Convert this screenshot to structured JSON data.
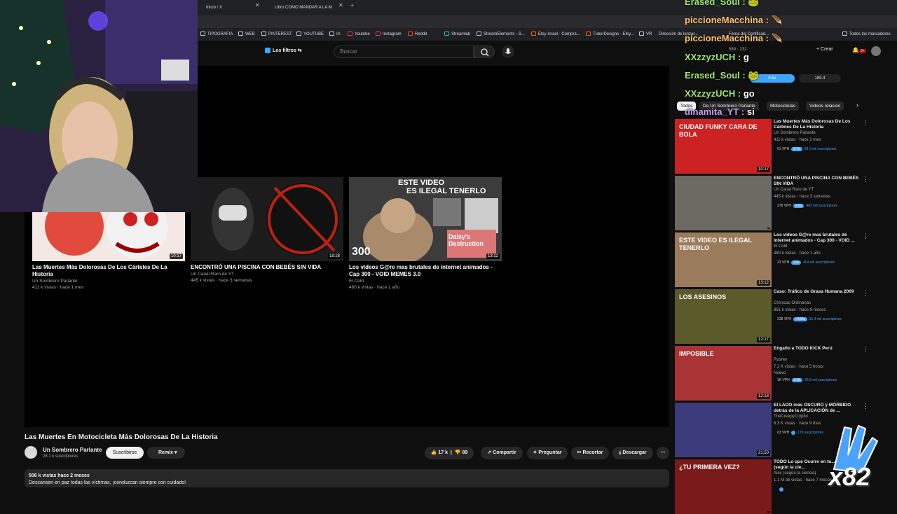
{
  "browser": {
    "tabs": [
      {
        "label": "Inicio / X"
      },
      {
        "label": "Libro COMO MANDAR A LA M"
      }
    ],
    "bookmarks": [
      "TIPOGRAFIA",
      "WEB",
      "PINTEREST",
      "YOUTUBE",
      "IA",
      "Youtube",
      "Instagram",
      "Reddit",
      "Streamlab",
      "StreamElements - S...",
      "Etsy Israel - Compra...",
      "TuberDesigns - Etsy...",
      "VR",
      "Dirección de lanzar...",
      "Fema del Certificad...",
      "Todos los marcadores"
    ]
  },
  "youtube_header": {
    "filters_label": "Los filtros",
    "search_placeholder": "Buscar",
    "create_label": "Crear",
    "notif_count": "9+",
    "vidiq_counts": [
      "589",
      "232"
    ],
    "speed_label": "4.5x",
    "score_label": "189.4"
  },
  "end_cards": [
    {
      "title": "Las Muertes Más Dolorosas De Los Cárteles De La Historia",
      "channel": "Un Sombrero Parlante",
      "meta": "411 k vistas · hace 1 mes",
      "duration": "10:17",
      "color": "#d33"
    },
    {
      "title": "ENCONTRÓ UNA PISCINA CON BEBÉS SIN VIDA",
      "channel": "Un Canal Raro de YT",
      "meta": "445 k vistas · hace 3 semanas",
      "duration": "18:28",
      "color": "#555"
    },
    {
      "title": "Los vídeos G@re mas brutales de internet animados - Cap 300 - VOID MEMES 3.0",
      "channel": "El Cold",
      "meta": "480 k vistas · hace 1 año",
      "duration": "13:12",
      "color": "#9a7b5b",
      "overlay_top": "ESTE VIDEO",
      "overlay_mid": "ES ILEGAL TENERLO",
      "overlay_num": "300",
      "overlay_tag": "Daisy's Destruction"
    }
  ],
  "video": {
    "title": "Las Muertes En Motocicleta Más Dolorosas De La Historia",
    "channel": "Un Sombrero Parlante",
    "subscribers": "28.1 k suscriptores",
    "subscribe_label": "Suscribirse",
    "remix_label": "Remix",
    "likes": "17 k",
    "dislikes": "89",
    "share_label": "Compartir",
    "ask_label": "Preguntar",
    "clip_label": "Recortar",
    "download_label": "Descargar",
    "views_line": "506 k vistas  hace 2 meses",
    "description": "Descansen en paz todas las víctimas, ¡conduzcan siempre con cuidado!"
  },
  "chips": [
    "Todos",
    "De Un Sombrero Parlante",
    "Motocicletas",
    "Videos relacion"
  ],
  "recommendations": [
    {
      "title": "Las Muertes Más Dolorosas De Los Cárteles De La Historia",
      "channel": "Un Sombrero Parlante",
      "views": "411 k vistas · hace 1 mes",
      "vph": "51 VPH",
      "mult": "3.7x",
      "subs": "28.1 mil suscriptores",
      "duration": "10:17",
      "color": "#c22",
      "thumb_text": "CIUDAD FUNKY   CARA DE BOLA"
    },
    {
      "title": "ENCONTRÓ UNA PISCINA CON BEBÉS SIN VIDA",
      "channel": "Un Canal Raro de YT",
      "views": "445 k vistas · hace 3 semanas",
      "vph": "278 VPH",
      "mult": "2.8x",
      "subs": "483 mil suscriptores",
      "duration": "",
      "color": "#6b6b64",
      "thumb_text": ""
    },
    {
      "title": "Los vídeos G@re mas brutales de internet animados - Cap 300 - VOID ...",
      "channel": "El Cold",
      "views": "480 k vistas · hace 1 año",
      "vph": "23 VPH",
      "mult": "13x",
      "subs": "404 mil suscriptores",
      "duration": "13:12",
      "color": "#9a7b5b",
      "thumb_text": "ESTE VIDEO ES ILEGAL TENERLO"
    },
    {
      "title": "Caso: Tráfico de Grasa Humana 2009",
      "channel": "Crónicas Ordinarias",
      "views": "861 k vistas · hace 9 meses",
      "vph": "238 VPH",
      "mult": ">100x",
      "subs": "51.4 mil suscriptores",
      "duration": "12:17",
      "color": "#5a5a2a",
      "thumb_text": "LOS ASESINOS"
    },
    {
      "title": "Engaño a TODO KICK Perú",
      "channel": "Rusher",
      "views": "7.2 K vistas · hace 5 horas",
      "vph": "1K VPH",
      "mult": "6.3x",
      "subs": "25.5 mil suscriptores",
      "duration": "12:18",
      "color": "#a33",
      "thumb_text": "IMPOSIBLE",
      "extra": "Nuevo"
    },
    {
      "title": "El LADO más OSCURO y MÓRBIDO detrás de la APLICACIÓN de ...",
      "channel": "TheCreepyCryptid",
      "views": "6.3 K vistas · hace 9 días",
      "vph": "63 VPH",
      "mult": "",
      "subs": "176 suscriptores",
      "duration": "21:50",
      "color": "#3b3a7a",
      "thumb_text": ""
    },
    {
      "title": "TODO Lo que Ocurre en tu... Tener S*xo (según la cie...",
      "channel": "Alex (según la ciencia)",
      "views": "1.1 M de vistas · hace 7 meses",
      "vph": "",
      "mult": "",
      "subs": "",
      "duration": "",
      "color": "#7a1a1a",
      "thumb_text": "¿TU PRIMERA VEZ?"
    }
  ],
  "chat": [
    {
      "user": "Erased_Soul",
      "message": ""
    },
    {
      "user": "piccioneMacchina",
      "message": ""
    },
    {
      "user": "piccioneMacchina",
      "message": ""
    },
    {
      "user": "XXzzyzUCH",
      "message": "g"
    },
    {
      "user": "Erased_Soul",
      "message": ""
    },
    {
      "user": "XXzzyzUCH",
      "message": "go"
    },
    {
      "user": "dinamita_YT",
      "message": "si"
    }
  ],
  "combo_label": "x82",
  "colors": {
    "chat_user": "#9fe870",
    "accent": "#3ea6ff",
    "bg": "#0f0f0f"
  }
}
